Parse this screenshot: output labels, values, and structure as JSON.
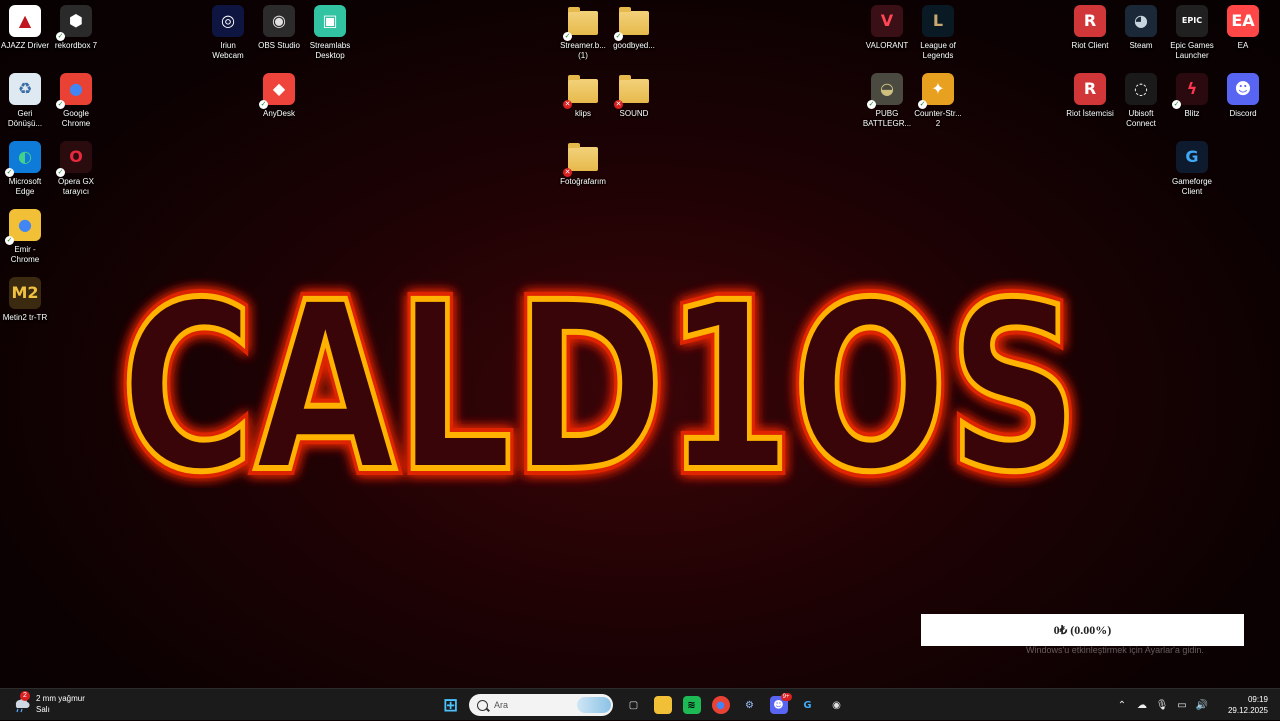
{
  "desktop": {
    "icons": [
      {
        "label": "AJAZZ Driver",
        "glyph": "▲",
        "color": "#ffffff",
        "fg": "#c0141e",
        "badge": ""
      },
      {
        "label": "rekordbox 7",
        "glyph": "⬢",
        "color": "#2a2a2a",
        "fg": "#ffffff",
        "badge": "ok"
      },
      {
        "label": "Geri\nDönüşü...",
        "glyph": "♻",
        "color": "#dfe9f2",
        "fg": "#3a6ea5",
        "badge": ""
      },
      {
        "label": "Google\nChrome",
        "glyph": "●",
        "color": "#e94235",
        "fg": "#4285f4",
        "badge": "ok"
      },
      {
        "label": "Microsoft\nEdge",
        "glyph": "◐",
        "color": "#0f7bd8",
        "fg": "#42d18b",
        "badge": "ok"
      },
      {
        "label": "Opera GX\ntarayıcı",
        "glyph": "O",
        "color": "#2a0b0e",
        "fg": "#e8283c",
        "badge": "ok"
      },
      {
        "label": "Emir -\nChrome",
        "glyph": "●",
        "color": "#f2c037",
        "fg": "#4285f4",
        "badge": "ok"
      },
      {
        "label": "Metin2 tr-TR",
        "glyph": "M2",
        "color": "#3b2a10",
        "fg": "#f0c040",
        "badge": ""
      },
      {
        "label": "Iriun\nWebcam",
        "glyph": "◎",
        "color": "#0d1540",
        "fg": "#ffffff",
        "badge": ""
      },
      {
        "label": "OBS Studio",
        "glyph": "◉",
        "color": "#2b2b2b",
        "fg": "#e0e0e0",
        "badge": ""
      },
      {
        "label": "Streamlabs\nDesktop",
        "glyph": "▣",
        "color": "#31c3a2",
        "fg": "#ffffff",
        "badge": ""
      },
      {
        "label": "AnyDesk",
        "glyph": "◆",
        "color": "#ef443b",
        "fg": "#ffffff",
        "badge": "ok"
      },
      {
        "label": "Streamer.b...\n(1)",
        "glyph": "",
        "color": "folder",
        "fg": "",
        "badge": "ok"
      },
      {
        "label": "goodbyed...",
        "glyph": "",
        "color": "folder",
        "fg": "",
        "badge": "ok"
      },
      {
        "label": "klips",
        "glyph": "",
        "color": "folder",
        "fg": "",
        "badge": "err"
      },
      {
        "label": "SOUND",
        "glyph": "",
        "color": "folder",
        "fg": "",
        "badge": "err"
      },
      {
        "label": "Fotoğrafarım",
        "glyph": "",
        "color": "folder",
        "fg": "",
        "badge": "err"
      },
      {
        "label": "VALORANT",
        "glyph": "V",
        "color": "#3a0f16",
        "fg": "#ff4655",
        "badge": ""
      },
      {
        "label": "League of\nLegends",
        "glyph": "L",
        "color": "#0a1a24",
        "fg": "#c8aa6e",
        "badge": ""
      },
      {
        "label": "PUBG\nBATTLEGR...",
        "glyph": "◒",
        "color": "#4a4a40",
        "fg": "#d0c080",
        "badge": "ok"
      },
      {
        "label": "Counter-Str...\n2",
        "glyph": "✦",
        "color": "#e8a020",
        "fg": "#ffffff",
        "badge": "ok"
      },
      {
        "label": "Riot Client",
        "glyph": "R",
        "color": "#d13639",
        "fg": "#ffffff",
        "badge": ""
      },
      {
        "label": "Steam",
        "glyph": "◕",
        "color": "#1b2838",
        "fg": "#c7d5e0",
        "badge": ""
      },
      {
        "label": "Epic Games\nLauncher",
        "glyph": "EPIC",
        "color": "#202020",
        "fg": "#ffffff",
        "badge": ""
      },
      {
        "label": "EA",
        "glyph": "EA",
        "color": "#ff4747",
        "fg": "#ffffff",
        "badge": ""
      },
      {
        "label": "Riot İstemcisi",
        "glyph": "R",
        "color": "#d13639",
        "fg": "#ffffff",
        "badge": ""
      },
      {
        "label": "Ubisoft\nConnect",
        "glyph": "◌",
        "color": "#1a1a1a",
        "fg": "#ffffff",
        "badge": ""
      },
      {
        "label": "Blitz",
        "glyph": "ϟ",
        "color": "#2a0a0e",
        "fg": "#ff3650",
        "badge": "ok"
      },
      {
        "label": "Discord",
        "glyph": "☻",
        "color": "#5865f2",
        "fg": "#ffffff",
        "badge": ""
      },
      {
        "label": "Gameforge\nClient",
        "glyph": "G",
        "color": "#0e1a2e",
        "fg": "#3fa9f5",
        "badge": ""
      }
    ]
  },
  "wallpaper": {
    "text": "CALD1OS",
    "stroke": "#ffb300",
    "glow": "#ff2a00"
  },
  "widget": {
    "balance": "0₺ (0.00%)",
    "watermark": "Windows'u etkinleştirmek için Ayarlar'a gidin."
  },
  "taskbar": {
    "weather": {
      "line1": "2 mm yağmur",
      "line2": "Salı",
      "alert": "2"
    },
    "search_placeholder": "Ara",
    "apps": [
      {
        "name": "start",
        "glyph": "⊞",
        "bg": "transparent",
        "fg": "#4cc2ff"
      },
      {
        "name": "task-view",
        "glyph": "▢",
        "bg": "transparent",
        "fg": "#dddddd"
      },
      {
        "name": "file-explorer",
        "glyph": "▬",
        "bg": "#f2c037",
        "fg": "#f2c037"
      },
      {
        "name": "spotify",
        "glyph": "≋",
        "bg": "#1db954",
        "fg": "#000000"
      },
      {
        "name": "chrome",
        "glyph": "●",
        "bg": "#e94235",
        "fg": "#4285f4"
      },
      {
        "name": "app-gear",
        "glyph": "⚙",
        "bg": "transparent",
        "fg": "#9ec3ff"
      },
      {
        "name": "discord",
        "glyph": "☻",
        "bg": "#5865f2",
        "fg": "#ffffff"
      },
      {
        "name": "gameforge",
        "glyph": "G",
        "bg": "transparent",
        "fg": "#3fa9f5"
      },
      {
        "name": "obs",
        "glyph": "◉",
        "bg": "transparent",
        "fg": "#e0e0e0"
      }
    ],
    "discord_badge": "9+",
    "clock": {
      "time": "09:19",
      "date": "29.12.2025"
    }
  }
}
